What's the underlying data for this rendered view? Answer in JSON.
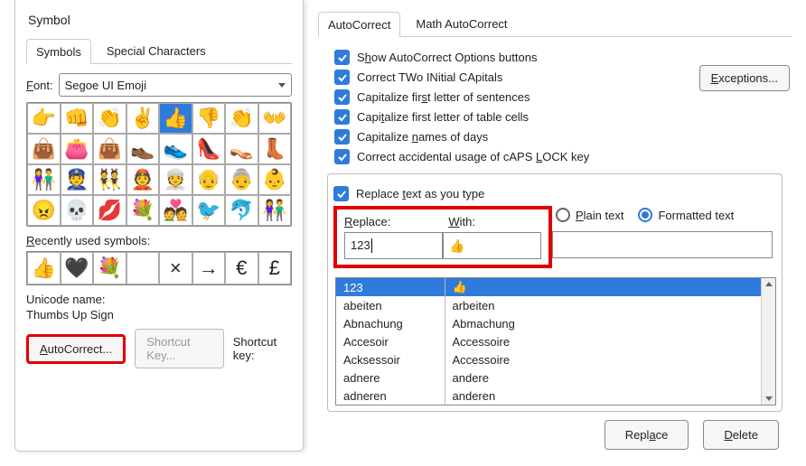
{
  "left": {
    "title": "Symbol",
    "tabs": [
      "Symbols",
      "Special Characters"
    ],
    "font_label": "Font:",
    "font_value": "Segoe UI Emoji",
    "grid": [
      "👉",
      "👊",
      "👏",
      "✌",
      "👍",
      "👎",
      "👏",
      "👐",
      "👜",
      "👛",
      "👜",
      "👞",
      "👟",
      "👠",
      "👡",
      "👢",
      "👫",
      "👮",
      "👯",
      "👲",
      "👳",
      "👴",
      "👵",
      "👶",
      "😠",
      "💀",
      "💋",
      "💐",
      "💑",
      "🐦",
      "🐬",
      "👫"
    ],
    "recent_label": "Recently used symbols:",
    "recent": [
      "👍",
      "🖤",
      "💐",
      "",
      "×",
      "→",
      "€",
      "£"
    ],
    "unicode_label": "Unicode name:",
    "unicode_name": "Thumbs Up Sign",
    "autocorrect_btn": "AutoCorrect...",
    "shortcut_btn": "Shortcut Key...",
    "shortcut_lbl": "Shortcut key:"
  },
  "right": {
    "tabs": [
      "AutoCorrect",
      "Math AutoCorrect"
    ],
    "checks": [
      "Show AutoCorrect Options buttons",
      "Correct TWo INitial CApitals",
      "Capitalize first letter of sentences",
      "Capitalize first letter of table cells",
      "Capitalize names of days",
      "Correct accidental usage of cAPS LOCK key"
    ],
    "exceptions": "Exceptions...",
    "replace_check": "Replace text as you type",
    "replace_lbl": "Replace:",
    "with_lbl": "With:",
    "plain": "Plain text",
    "formatted": "Formatted text",
    "replace_val": "123",
    "with_val": "👍",
    "rows": [
      [
        "123",
        "👍"
      ],
      [
        "abeiten",
        "arbeiten"
      ],
      [
        "Abnachung",
        "Abmachung"
      ],
      [
        "Accesoir",
        "Accessoire"
      ],
      [
        "Acksessoir",
        "Accessoire"
      ],
      [
        "adnere",
        "andere"
      ],
      [
        "adneren",
        "anderen"
      ]
    ],
    "replace_btn": "Replace",
    "delete_btn": "Delete"
  }
}
